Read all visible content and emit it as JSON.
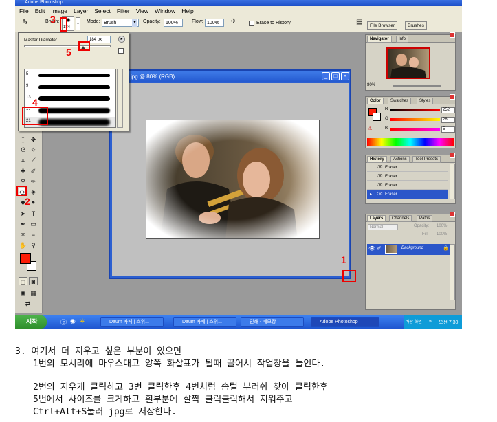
{
  "window": {
    "title": "Adobe Photoshop"
  },
  "menu": [
    "File",
    "Edit",
    "Image",
    "Layer",
    "Select",
    "Filter",
    "View",
    "Window",
    "Help"
  ],
  "options": {
    "brush_label": "Brush:",
    "brush_size": "184",
    "mode_label": "Mode:",
    "mode_value": "Brush",
    "opacity_label": "Opacity:",
    "opacity_value": "100%",
    "flow_label": "Flow:",
    "flow_value": "100%",
    "erase_to_history": "Erase to History",
    "tab_file_browser": "File Browser",
    "tab_brushes": "Brushes"
  },
  "brush_popup": {
    "master_diameter_label": "Master Diameter",
    "master_diameter_value": "184 px",
    "brush_sizes": [
      "5",
      "9",
      "13",
      "17",
      "21"
    ]
  },
  "document": {
    "title": "jpg @ 80% (RGB)"
  },
  "navigator": {
    "tab_navigator": "Navigator",
    "tab_info": "Info",
    "zoom": "80%"
  },
  "color_panel": {
    "tab_color": "Color",
    "tab_swatches": "Swatches",
    "tab_styles": "Styles",
    "r_label": "R",
    "r_value": "252",
    "g_label": "G",
    "g_value": "28",
    "b_label": "B",
    "b_value": "5",
    "foreground_color": "#fc1c05"
  },
  "history": {
    "tab_history": "History",
    "tab_actions": "Actions",
    "tab_tool_presets": "Tool Presets",
    "items": [
      "Eraser",
      "Eraser",
      "Eraser",
      "Eraser"
    ]
  },
  "layers": {
    "tab_layers": "Layers",
    "tab_channels": "Channels",
    "tab_paths": "Paths",
    "mode_value": "Normal",
    "opacity_label": "Opacity:",
    "opacity_value": "100%",
    "fill_label": "Fill:",
    "fill_value": "100%",
    "layer_name": "Background"
  },
  "taskbar": {
    "start_label": "시작",
    "tasks": [
      "Daum 카페 | 스위...",
      "Daum 카페 | 스위...",
      "인쇄 - 메모장",
      "Adobe Photoshop"
    ],
    "desktop_label": "바탕 화면",
    "clock": "오전 7:30"
  },
  "annotations": [
    "1",
    "2",
    "3",
    "4",
    "5"
  ],
  "instructions": {
    "line1": "3. 여기서 더 지우고 싶은 부분이 있으면",
    "line2": "1번의 모서리에 마우스대고 양쪽 화살표가 될때 끌어서 작업창을 늘인다.",
    "line3": "2번의 지우개 클릭하고 3번 클릭한후 4번처럼 솜털 부러쉬 찾아 클릭한후",
    "line4": "5번에서 사이즈를 크게하고 흰부분에 살짝 클릭클릭해서 지워주고",
    "line5": "Ctrl+Alt+S눌러 jpg로 저장한다."
  }
}
